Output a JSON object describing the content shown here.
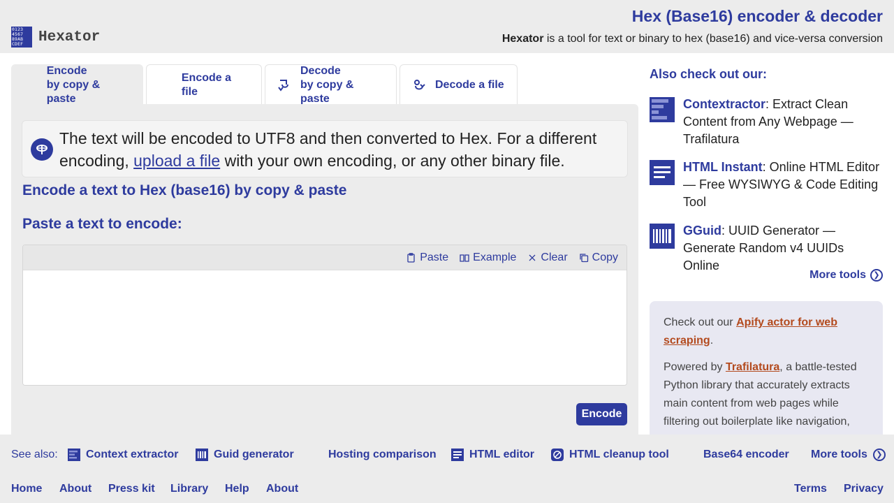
{
  "header": {
    "logo_glyphs": "0123 4567 89AB CDEF",
    "logo_text": "Hexator",
    "title": "Hex (Base16) encoder & decoder",
    "tagline_brand": "Hexator",
    "tagline_rest": " is a tool for text or binary to hex (base16) and vice-versa conversion"
  },
  "tabs": [
    {
      "line1": "Encode",
      "line2": "by copy & paste",
      "active": true
    },
    {
      "line1": "Encode a file",
      "line2": "",
      "active": false
    },
    {
      "line1": "Decode",
      "line2": "by copy & paste",
      "active": false
    },
    {
      "line1": "Decode a file",
      "line2": "",
      "active": false
    }
  ],
  "notice": {
    "text_before": "The text will be encoded to UTF8 and then converted to Hex. For a different encoding, ",
    "link": "upload a file",
    "text_after": " with your own encoding, or any other binary file."
  },
  "main": {
    "heading": "Encode a text to Hex (base16) by copy & paste",
    "paste_label": "Paste a text to encode:",
    "toolbar": {
      "paste": "Paste",
      "example": "Example",
      "clear": "Clear",
      "copy": "Copy"
    },
    "input_value": "",
    "encode_button": "Encode"
  },
  "sidebar": {
    "title": "Also check out our:",
    "items": [
      {
        "name": "Contextractor",
        "desc": ": Extract Clean Content from Any Webpage — Trafilatura",
        "icon": "contextractor-icon"
      },
      {
        "name": "HTML Instant",
        "desc": ": Online HTML Editor — Free WYSIWYG & Code Editing Tool",
        "icon": "document-lines-icon"
      },
      {
        "name": "GGuid",
        "desc": ": UUID Generator — Generate Random v4 UUIDs Online",
        "icon": "barcode-icon"
      }
    ],
    "more_tools": "More tools",
    "promo": {
      "p1_before": "Check out our ",
      "p1_link": "Apify actor for web scraping",
      "p1_after": ".",
      "p2_before": "Powered by ",
      "p2_link": "Trafilatura",
      "p2_after": ", a battle-tested Python library that accurately extracts main content from web pages while filtering out boilerplate like navigation,"
    }
  },
  "footer": {
    "see_also": "See also:",
    "links": [
      "Context extractor",
      "Guid generator",
      "Hosting comparison",
      "HTML editor",
      "HTML cleanup tool",
      "Base64 encoder",
      "More tools"
    ],
    "nav": [
      "Home",
      "About",
      "Press kit",
      "Library",
      "Help",
      "About"
    ],
    "legal": [
      "Terms",
      "Privacy"
    ]
  },
  "colors": {
    "accent": "#2e3b9e",
    "promo_link": "#b34a1e",
    "background_gray": "#ececec"
  }
}
